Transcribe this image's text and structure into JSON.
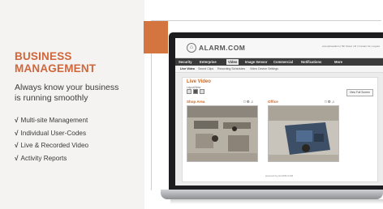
{
  "marketing": {
    "headline_line1": "BUSINESS",
    "headline_line2": "MANAGEMENT",
    "tagline_line1": "Always know your business",
    "tagline_line2": "is running smoothly",
    "checkmark": "√",
    "features": [
      "Multi-site Management",
      "Individual User-Codes",
      "Live & Recorded Video",
      "Activity Reports"
    ]
  },
  "app": {
    "brand": "ALARM.COM",
    "user_links": "enterpriseadmin  |  5th Street  |  ⚙  |  Contact Us  |  Logout",
    "nav": [
      "Security",
      "Enterprise",
      "Video",
      "Image Sensor",
      "Commercial",
      "Notifications",
      "More"
    ],
    "subnav": [
      "Live Video",
      "Saved Clips",
      "Recording Schedules",
      "Video Device Settings"
    ],
    "section_title": "Live Video",
    "layout_label": "Layout/View",
    "full_screen_label": "View Full Screen",
    "cameras": [
      {
        "title": "Shop Area",
        "icons": "□⚙♫"
      },
      {
        "title": "Office",
        "icons": "□⚙♫"
      }
    ],
    "footer": "powered by  ALARM.COM"
  },
  "colors": {
    "accent_orange": "#d1663a",
    "nav_dark": "#3b3b3b"
  }
}
